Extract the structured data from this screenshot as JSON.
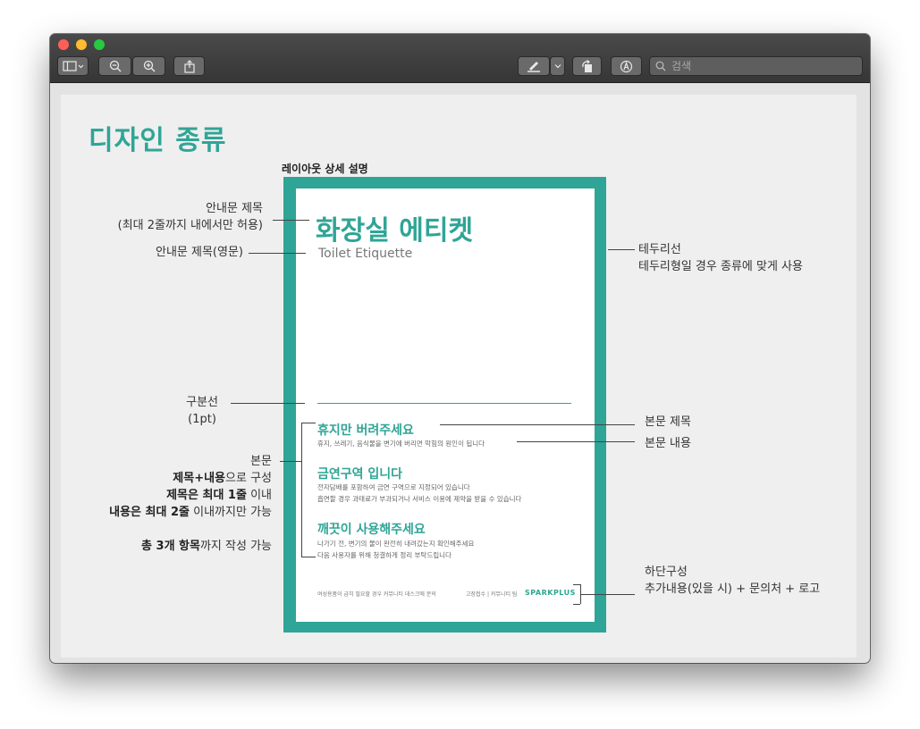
{
  "toolbar": {
    "search_placeholder": "검색"
  },
  "page": {
    "title": "디자인 종류",
    "layout_title": "레이아웃 상세 설명"
  },
  "sign": {
    "title": "화장실 에티켓",
    "subtitle": "Toilet Etiquette",
    "sections": [
      {
        "title": "휴지만 버려주세요",
        "lines": [
          "휴지, 쓰레기, 음식물을 변기에 버리면 막힘의 원인이 됩니다"
        ]
      },
      {
        "title": "금연구역 입니다",
        "lines": [
          "전자담배를 포함하여 금연 구역으로 지정되어 있습니다",
          "흡연할 경우 과태료가 부과되거나 서비스 이용에 제약을 받을 수 있습니다"
        ]
      },
      {
        "title": "깨끗이 사용해주세요",
        "lines": [
          "나가기 전, 변기의 물이 완전히 내려갔는지 확인해주세요",
          "다음 사용자를 위해 청결하게 정리 부탁드립니다"
        ]
      }
    ],
    "footer_left": "여성용품이 급히 필요할 경우 커뮤니티 데스크에 문의",
    "footer_contact": "고장접수 | 커뮤니티 팀",
    "brand": "SPARKPLUS"
  },
  "annotations": {
    "title_label": "안내문 제목",
    "title_note": "(최대 2줄까지 내에서만 허용)",
    "subtitle_label": "안내문 제목(영문)",
    "border_label": "테두리선",
    "border_note": "테두리형일 경우 종류에 맞게 사용",
    "divider_label": "구분선",
    "divider_note": "(1pt)",
    "body_label": "본문",
    "body_line1_bold": "제목+내용",
    "body_line1_rest": "으로 구성",
    "body_line2_bold": "제목은 최대 1줄",
    "body_line2_rest": " 이내",
    "body_line3_bold": "내용은 최대 2줄",
    "body_line3_rest": " 이내까지만 가능",
    "body_line4_bold": "총 3개 항목",
    "body_line4_rest": "까지 작성 가능",
    "body_title_label": "본문 제목",
    "body_content_label": "본문 내용",
    "footer_label": "하단구성",
    "footer_note": "추가내용(있을 시) + 문의처 + 로고"
  },
  "colors": {
    "accent": "#2fa596",
    "close": "#fd5f57",
    "minimize": "#febc2e",
    "zoom": "#28c840"
  }
}
